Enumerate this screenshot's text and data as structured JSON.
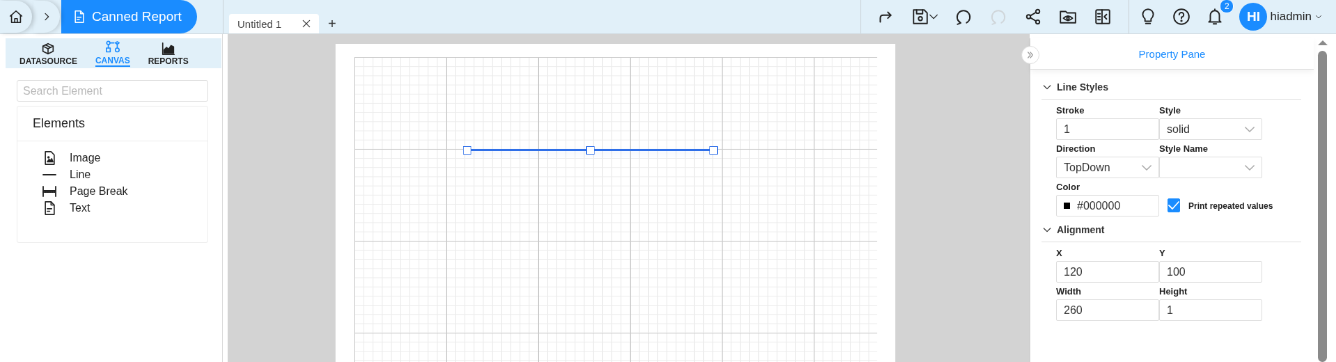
{
  "breadcrumb": {
    "title": "Canned Report"
  },
  "tabs": [
    {
      "label": "Untitled 1",
      "selected": true
    }
  ],
  "new_tab": "+",
  "toolbar": [
    {
      "kind": "redo",
      "disabled": false
    },
    {
      "kind": "save",
      "disabled": false
    },
    {
      "kind": "refresh",
      "disabled": false
    },
    {
      "kind": "refresh",
      "disabled": true
    },
    {
      "kind": "share",
      "disabled": false
    },
    {
      "kind": "preview",
      "disabled": false
    },
    {
      "kind": "panel",
      "disabled": false
    }
  ],
  "utilities": [
    {
      "kind": "bulb"
    },
    {
      "kind": "help"
    },
    {
      "kind": "bell",
      "badge": "2"
    }
  ],
  "user": {
    "initials": "HI",
    "name": "hiadmin"
  },
  "left_tabs": [
    {
      "kind": "datasource",
      "label": "DATASOURCE",
      "selected": false
    },
    {
      "kind": "canvas",
      "label": "CANVAS",
      "selected": true
    },
    {
      "kind": "reports",
      "label": "REPORTS",
      "selected": false
    }
  ],
  "search": {
    "placeholder": "Search Element"
  },
  "elements": {
    "title": "Elements",
    "items": [
      {
        "kind": "image",
        "label": "Image"
      },
      {
        "kind": "line",
        "label": "Line"
      },
      {
        "kind": "pagebreak",
        "label": "Page Break"
      },
      {
        "kind": "text",
        "label": "Text"
      }
    ]
  },
  "canvas": {
    "line": {
      "selected": true
    }
  },
  "property_pane": {
    "title": "Property Pane",
    "sections": [
      {
        "title": "Line Styles",
        "expanded": true,
        "fields": [
          {
            "kind": "input",
            "label": "Stroke",
            "value": "1"
          },
          {
            "kind": "select",
            "label": "Style",
            "value": "solid"
          },
          {
            "kind": "select",
            "label": "Direction",
            "value": "TopDown"
          },
          {
            "kind": "select",
            "label": "Style Name"
          },
          {
            "kind": "color",
            "label": "Color",
            "value": "#000000"
          },
          {
            "kind": "checkbox",
            "label": "Print repeated values",
            "checked": true
          }
        ]
      },
      {
        "title": "Alignment",
        "expanded": true,
        "fields": [
          {
            "kind": "input",
            "label": "X",
            "value": "120"
          },
          {
            "kind": "input",
            "label": "Y",
            "value": "100"
          },
          {
            "kind": "input",
            "label": "Width",
            "value": "260"
          },
          {
            "kind": "input",
            "label": "Height",
            "value": "1"
          }
        ]
      }
    ]
  }
}
